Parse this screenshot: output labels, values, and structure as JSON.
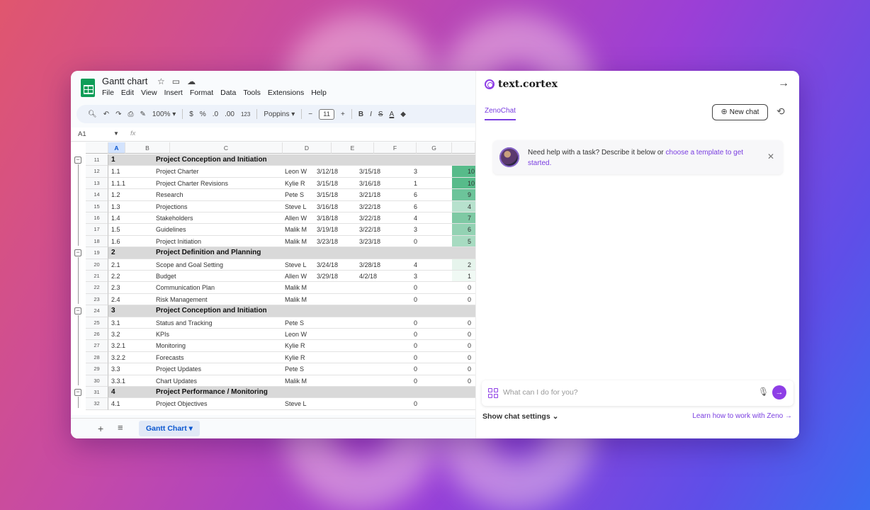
{
  "sheets": {
    "title": "Gantt chart",
    "title_icons": [
      "star-icon",
      "folder-move-icon",
      "cloud-status-icon"
    ],
    "menus": [
      "File",
      "Edit",
      "View",
      "Insert",
      "Format",
      "Data",
      "Tools",
      "Extensions",
      "Help"
    ],
    "toolbar": {
      "zoom": "100%",
      "currency": "$",
      "percent": "%",
      "dec_decrease": ".0",
      "dec_increase": ".00",
      "number_format": "123",
      "font": "Poppins",
      "font_size": "11",
      "bold": "B",
      "italic": "I",
      "strike": "S",
      "text_color": "A"
    },
    "name_box": "A1",
    "fx": "fx",
    "columns": [
      "A",
      "B",
      "C",
      "D",
      "E",
      "F",
      "G"
    ],
    "rows": [
      {
        "num": "11",
        "group": true,
        "b": "1",
        "c": "Project Conception and Initiation"
      },
      {
        "num": "12",
        "b": "1.1",
        "c": "Project Charter",
        "d": "Leon W",
        "e": "3/12/18",
        "f": "3/15/18",
        "g": "3",
        "h": "10"
      },
      {
        "num": "13",
        "b": "1.1.1",
        "c": "Project Charter Revisions",
        "d": "Kylie R",
        "e": "3/15/18",
        "f": "3/16/18",
        "g": "1",
        "h": "10"
      },
      {
        "num": "14",
        "b": "1.2",
        "c": "Research",
        "d": "Pete S",
        "e": "3/15/18",
        "f": "3/21/18",
        "g": "6",
        "h": "9"
      },
      {
        "num": "15",
        "b": "1.3",
        "c": "Projections",
        "d": "Steve L",
        "e": "3/16/18",
        "f": "3/22/18",
        "g": "6",
        "h": "4"
      },
      {
        "num": "16",
        "b": "1.4",
        "c": "Stakeholders",
        "d": "Allen W",
        "e": "3/18/18",
        "f": "3/22/18",
        "g": "4",
        "h": "7"
      },
      {
        "num": "17",
        "b": "1.5",
        "c": "Guidelines",
        "d": "Malik M",
        "e": "3/19/18",
        "f": "3/22/18",
        "g": "3",
        "h": "6"
      },
      {
        "num": "18",
        "b": "1.6",
        "c": "Project Initiation",
        "d": "Malik M",
        "e": "3/23/18",
        "f": "3/23/18",
        "g": "0",
        "h": "5"
      },
      {
        "num": "19",
        "group": true,
        "b": "2",
        "c": "Project Definition and Planning"
      },
      {
        "num": "20",
        "b": "2.1",
        "c": "Scope and Goal Setting",
        "d": "Steve L",
        "e": "3/24/18",
        "f": "3/28/18",
        "g": "4",
        "h": "2"
      },
      {
        "num": "21",
        "b": "2.2",
        "c": "Budget",
        "d": "Allen W",
        "e": "3/29/18",
        "f": "4/2/18",
        "g": "3",
        "h": "1"
      },
      {
        "num": "22",
        "b": "2.3",
        "c": "Communication Plan",
        "d": "Malik M",
        "e": "",
        "f": "",
        "g": "0",
        "h": "0"
      },
      {
        "num": "23",
        "b": "2.4",
        "c": "Risk Management",
        "d": "Malik M",
        "e": "",
        "f": "",
        "g": "0",
        "h": "0"
      },
      {
        "num": "24",
        "group": true,
        "b": "3",
        "c": "Project Conception and Initiation"
      },
      {
        "num": "25",
        "b": "3.1",
        "c": "Status and Tracking",
        "d": "Pete S",
        "e": "",
        "f": "",
        "g": "0",
        "h": "0"
      },
      {
        "num": "26",
        "b": "3.2",
        "c": "KPIs",
        "d": "Leon W",
        "e": "",
        "f": "",
        "g": "0",
        "h": "0"
      },
      {
        "num": "27",
        "b": "3.2.1",
        "c": "Monitoring",
        "d": "Kylie R",
        "e": "",
        "f": "",
        "g": "0",
        "h": "0"
      },
      {
        "num": "28",
        "b": "3.2.2",
        "c": "Forecasts",
        "d": "Kylie R",
        "e": "",
        "f": "",
        "g": "0",
        "h": "0"
      },
      {
        "num": "29",
        "b": "3.3",
        "c": "Project Updates",
        "d": "Pete S",
        "e": "",
        "f": "",
        "g": "0",
        "h": "0"
      },
      {
        "num": "30",
        "b": "3.3.1",
        "c": "Chart Updates",
        "d": "Malik M",
        "e": "",
        "f": "",
        "g": "0",
        "h": "0"
      },
      {
        "num": "31",
        "group": true,
        "b": "4",
        "c": "Project Performance / Monitoring"
      },
      {
        "num": "32",
        "b": "4.1",
        "c": "Project Objectives",
        "d": "Steve L",
        "e": "",
        "f": "",
        "g": "0",
        "h": ""
      }
    ],
    "green_shades": [
      "#57bb8a",
      "#57bb8a",
      "#6cc49a",
      "#b7e1cd",
      "#7ec9a4",
      "#93d2b3",
      "#a7dbc1",
      "",
      "#e6f4ec",
      "#f0f9f4"
    ],
    "sheet_tab": "Gantt Chart"
  },
  "panel": {
    "brand": "text.cortex",
    "tab": "ZenoChat",
    "new_chat": "New chat",
    "welcome_text": "Need help with a task? Describe it below or ",
    "welcome_link": "choose a template to get started.",
    "input_placeholder": "What can I do for you?",
    "show_settings": "Show chat settings",
    "learn_link": "Learn how to work with Zeno",
    "accent": "#8e3ee6"
  }
}
